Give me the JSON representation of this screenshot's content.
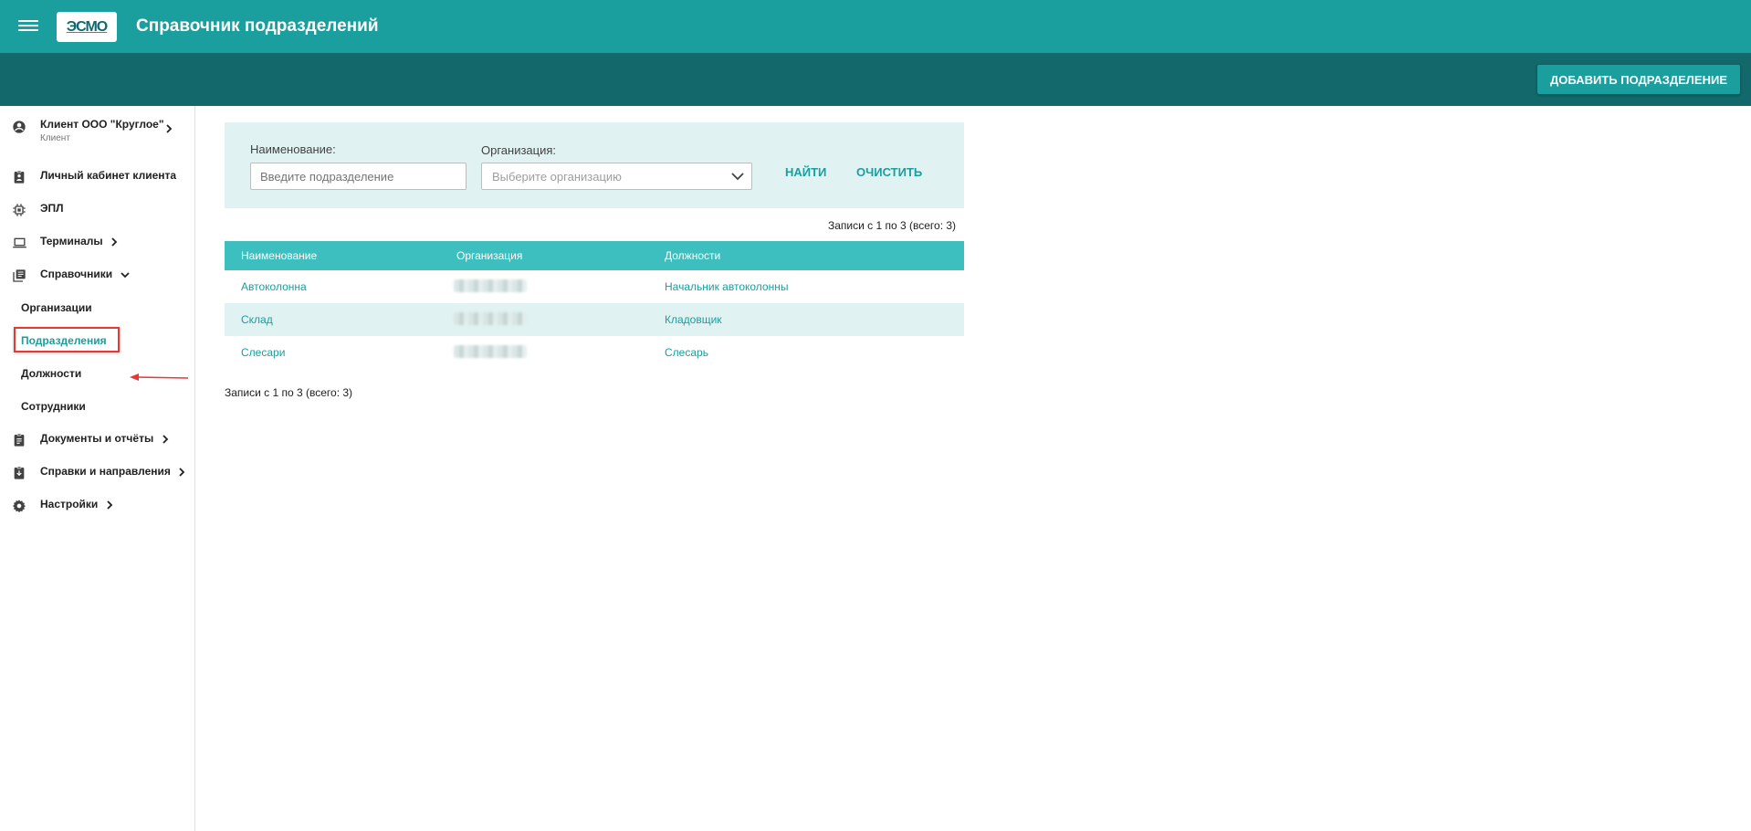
{
  "header": {
    "logo_text": "ЭСМО",
    "title": "Справочник подразделений"
  },
  "actionbar": {
    "add_button": "ДОБАВИТЬ ПОДРАЗДЕЛЕНИЕ"
  },
  "sidebar": {
    "client": {
      "name": "Клиент ООО \"Круглое\"",
      "role": "Клиент"
    },
    "items": [
      {
        "label": "Личный кабинет клиента",
        "icon": "assignment-ind-icon"
      },
      {
        "label": "ЭПЛ",
        "icon": "chip-icon"
      },
      {
        "label": "Терминалы",
        "icon": "laptop-icon"
      },
      {
        "label": "Справочники",
        "icon": "library-books-icon"
      },
      {
        "label": "Документы и отчёты",
        "icon": "assignment-icon"
      },
      {
        "label": "Справки и направления",
        "icon": "assignment-returned-icon"
      },
      {
        "label": "Настройки",
        "icon": "gear-icon"
      }
    ],
    "subitems": [
      {
        "label": "Организации"
      },
      {
        "label": "Подразделения"
      },
      {
        "label": "Должности"
      },
      {
        "label": "Сотрудники"
      }
    ]
  },
  "filter": {
    "name_label": "Наименование:",
    "name_placeholder": "Введите подразделение",
    "org_label": "Организация:",
    "org_placeholder": "Выберите организацию",
    "find_button": "НАЙТИ",
    "clear_button": "ОЧИСТИТЬ"
  },
  "records_top": "Записи с 1 по 3 (всего: 3)",
  "records_bottom": "Записи с 1 по 3 (всего: 3)",
  "table": {
    "columns": [
      "Наименование",
      "Организация",
      "Должности"
    ],
    "rows": [
      {
        "name": "Автоколонна",
        "organization": "",
        "positions": "Начальник автоколонны"
      },
      {
        "name": "Склад",
        "organization": "",
        "positions": "Кладовщик"
      },
      {
        "name": "Слесари",
        "organization": "",
        "positions": "Слесарь"
      }
    ]
  },
  "colors": {
    "header": "#1a9e9e",
    "actionbar": "#12686a",
    "table_header": "#3dbfbf",
    "accent": "#1a9e9e",
    "highlight": "#e53935"
  }
}
